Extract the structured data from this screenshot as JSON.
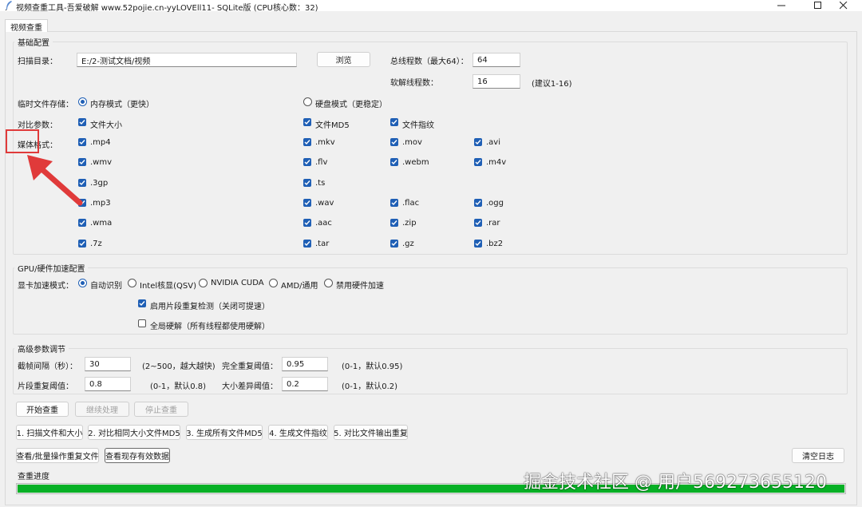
{
  "window": {
    "title": "视频查重工具-吾爱破解 www.52pojie.cn-yyLOVEll11- SQLite版 (CPU核心数：32)"
  },
  "tab": {
    "label": "视频查重"
  },
  "basic": {
    "group_title": "基础配置",
    "scan_dir_label": "扫描目录：",
    "scan_dir_value": "E:/2-测试文档/视频",
    "browse_label": "浏览",
    "total_threads_label": "总线程数（最大64）：",
    "total_threads_value": "64",
    "decode_threads_label": "软解线程数：",
    "decode_threads_value": "16",
    "decode_threads_hint": "(建议1-16)",
    "temp_storage_label": "临时文件存储：",
    "memory_mode_label": "内存模式（更快）",
    "disk_mode_label": "硬盘模式（更稳定）",
    "compare_params_label": "对比参数：",
    "file_size_label": "文件大小",
    "file_md5_label": "文件MD5",
    "file_fingerprint_label": "文件指纹",
    "media_formats_label": "媒体格式：",
    "formats": {
      "mp4": ".mp4",
      "mkv": ".mkv",
      "mov": ".mov",
      "avi": ".avi",
      "wmv": ".wmv",
      "flv": ".flv",
      "webm": ".webm",
      "m4v": ".m4v",
      "3gp": ".3gp",
      "ts": ".ts",
      "mp3": ".mp3",
      "wav": ".wav",
      "flac": ".flac",
      "ogg": ".ogg",
      "wma": ".wma",
      "aac": ".aac",
      "zip": ".zip",
      "rar": ".rar",
      "7z": ".7z",
      "tar": ".tar",
      "gz": ".gz",
      "bz2": ".bz2"
    }
  },
  "gpu": {
    "group_title": "GPU/硬件加速配置",
    "mode_label": "显卡加速模式：",
    "auto_label": "自动识别",
    "intel_label": "Intel核显(QSV)",
    "nvidia_label": "NVIDIA CUDA",
    "amd_label": "AMD/通用",
    "disable_label": "禁用硬件加速",
    "segment_detect_label": "启用片段重复检测（关闭可提速）",
    "global_hw_label": "全局硬解（所有线程都使用硬解）"
  },
  "advanced": {
    "group_title": "高级参数调节",
    "frame_interval_label": "截帧间隔（秒）：",
    "frame_interval_value": "30",
    "frame_interval_hint": "(2~500，越大越快)",
    "full_dup_label": "完全重复阈值：",
    "full_dup_value": "0.95",
    "full_dup_hint": "(0-1，默认0.95)",
    "segment_dup_label": "片段重复阈值：",
    "segment_dup_value": "0.8",
    "segment_dup_hint": "(0-1，默认0.8)",
    "size_diff_label": "大小差异阈值：",
    "size_diff_value": "0.2",
    "size_diff_hint": "(0-1，默认0.2)"
  },
  "actions": {
    "start": "开始查重",
    "continue": "继续处理",
    "stop": "停止查重",
    "step1": "1. 扫描文件和大小",
    "step2": "2. 对比相同大小文件MD5",
    "step3": "3. 生成所有文件MD5",
    "step4": "4. 生成文件指纹",
    "step5": "5. 对比文件输出重复",
    "view_batch": "查看/批量操作重复文件",
    "view_valid": "查看现存有效数据",
    "clear_log": "清空日志"
  },
  "progress": {
    "label": "查重进度",
    "value_fraction": 1.0,
    "color": "#06b025"
  },
  "watermark": "掘金技术社区 @ 用户569273655120",
  "colors": {
    "accent": "#1f5fb5",
    "annotation": "#e03a3a"
  }
}
